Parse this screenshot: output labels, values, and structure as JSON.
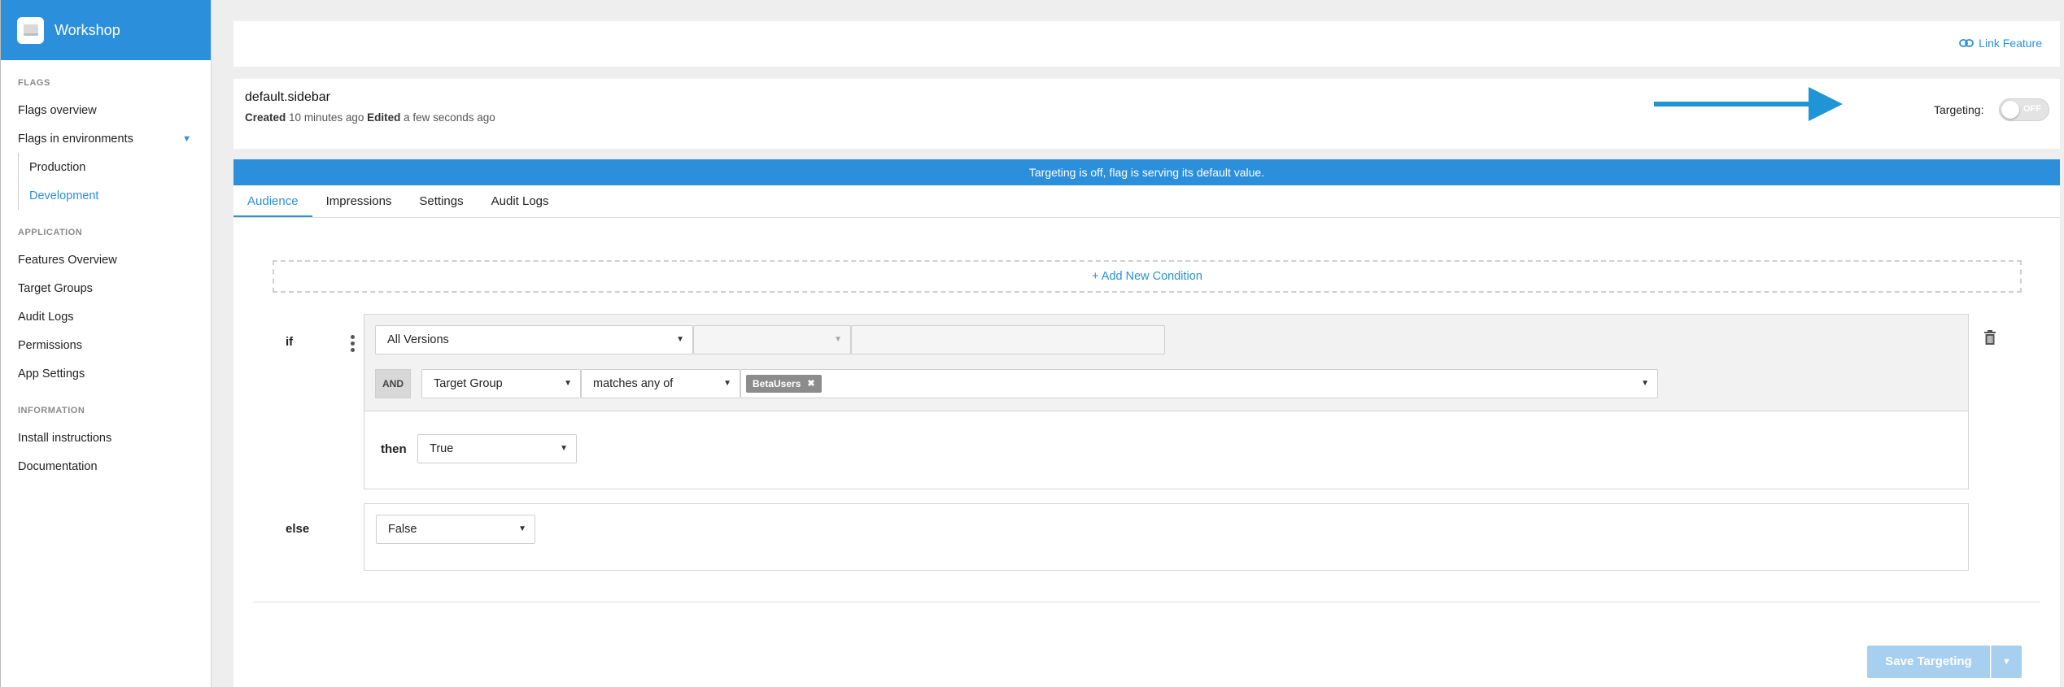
{
  "app": {
    "name": "Workshop"
  },
  "sidebar": {
    "sections": [
      {
        "heading": "FLAGS",
        "items": [
          {
            "label": "Flags overview"
          },
          {
            "label": "Flags in environments"
          },
          {
            "label": "Production"
          },
          {
            "label": "Development"
          }
        ]
      },
      {
        "heading": "APPLICATION",
        "items": [
          {
            "label": "Features Overview"
          },
          {
            "label": "Target Groups"
          },
          {
            "label": "Audit Logs"
          },
          {
            "label": "Permissions"
          },
          {
            "label": "App Settings"
          }
        ]
      },
      {
        "heading": "INFORMATION",
        "items": [
          {
            "label": "Install instructions"
          },
          {
            "label": "Documentation"
          }
        ]
      }
    ],
    "caret": "▼"
  },
  "topbar": {
    "link_feature": "Link Feature"
  },
  "flag": {
    "name": "default.sidebar",
    "created_label": "Created",
    "created_value": "10 minutes ago",
    "edited_label": "Edited",
    "edited_value": "a few seconds ago",
    "targeting_label": "Targeting:",
    "toggle_text": "OFF",
    "targeting_enabled": false
  },
  "banner": {
    "text": "Targeting is off, flag is serving its default value."
  },
  "tabs": [
    {
      "label": "Audience",
      "active": true
    },
    {
      "label": "Impressions",
      "active": false
    },
    {
      "label": "Settings",
      "active": false
    },
    {
      "label": "Audit Logs",
      "active": false
    }
  ],
  "rules": {
    "add_condition": "+ Add New Condition",
    "if_label": "if",
    "then_label": "then",
    "else_label": "else",
    "version_select": "All Versions",
    "version_operator": "",
    "version_value": "",
    "and_label": "AND",
    "attribute_select": "Target Group",
    "operator_select": "matches any of",
    "chip": "BetaUsers",
    "chip_remove": "✖",
    "then_value": "True",
    "else_value": "False"
  },
  "footer": {
    "save_label": "Save Targeting",
    "save_caret": "▼"
  },
  "colors": {
    "brand": "#2b8fdc",
    "save_disabled": "#a6cff0",
    "chip": "#8c8c8c"
  }
}
